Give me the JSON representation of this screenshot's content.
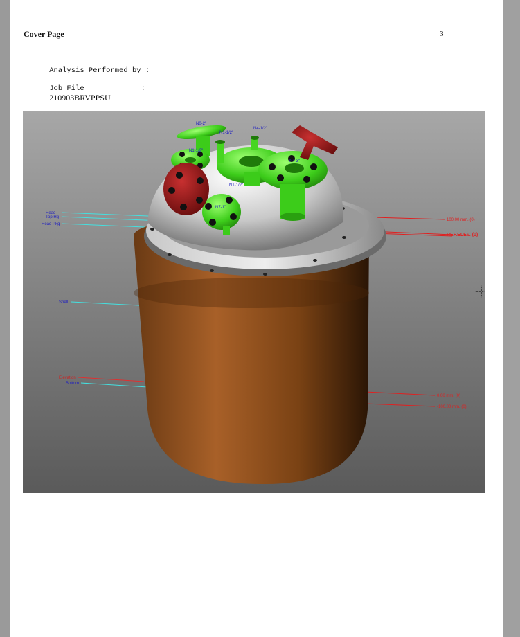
{
  "header": {
    "title": "Cover Page",
    "page_number": "3"
  },
  "fields": {
    "analysis_label": "Analysis Performed by :",
    "analysis_value": "",
    "job_label": "Job File             :",
    "job_value": "210903BRVPPSU"
  },
  "model": {
    "shell_color": "#8a4a1a",
    "head_color": "#d6d6d6",
    "nozzle_color": "#44dd22",
    "flange_red": "#8a1010",
    "label_left_blue": [
      "Head",
      "Top Hg",
      "Head Pkg",
      "Shell",
      "Bottom"
    ],
    "label_left_red": [
      "Elevation"
    ],
    "label_right_red": [
      "100.00 mm. (0)",
      "REF.ELEV. (0)",
      "0.00 mm. (0)",
      "-100.00 mm. (0)"
    ],
    "nozzle_labels": [
      "N0-2\"",
      "N1-1/2\"",
      "N4-1/2\"",
      "N1-1/2\"",
      "N4-3\"",
      "N1-1/2\"",
      "N7-1\""
    ]
  }
}
